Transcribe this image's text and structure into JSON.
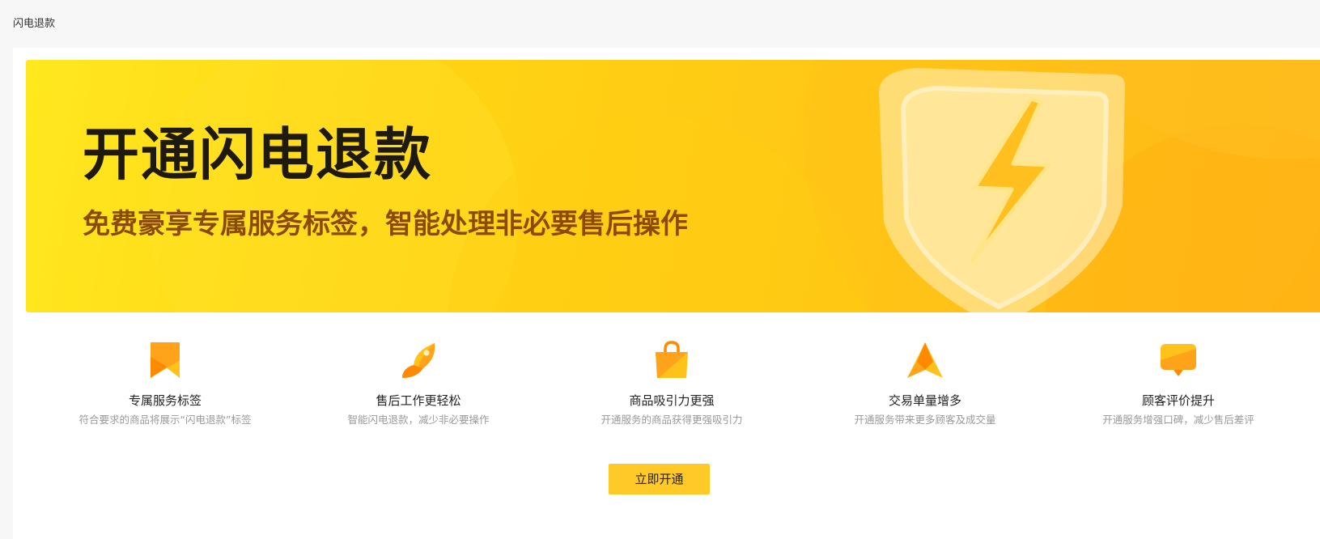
{
  "page": {
    "title": "闪电退款"
  },
  "banner": {
    "title": "开通闪电退款",
    "subtitle": "免费豪享专属服务标签，智能处理非必要售后操作"
  },
  "features": [
    {
      "icon": "bookmark-icon",
      "title": "专属服务标签",
      "desc": "符合要求的商品将展示“闪电退款”标签"
    },
    {
      "icon": "rocket-icon",
      "title": "售后工作更轻松",
      "desc": "智能闪电退款，减少非必要操作"
    },
    {
      "icon": "shopping-bag-icon",
      "title": "商品吸引力更强",
      "desc": "开通服务的商品获得更强吸引力"
    },
    {
      "icon": "up-arrow-icon",
      "title": "交易单量增多",
      "desc": "开通服务带来更多顾客及成交量"
    },
    {
      "icon": "chat-bubble-icon",
      "title": "顾客评价提升",
      "desc": "开通服务增强口碑，减少售后差评"
    }
  ],
  "cta": {
    "label": "立即开通"
  },
  "colors": {
    "accent": "#ffc927",
    "banner_start": "#ffe81f",
    "banner_end": "#ffb716",
    "title_text": "#1e1a0f",
    "subtitle_text": "#8c4a09",
    "icon_orange": "#ff8a00",
    "icon_yellow": "#ffc21a"
  }
}
